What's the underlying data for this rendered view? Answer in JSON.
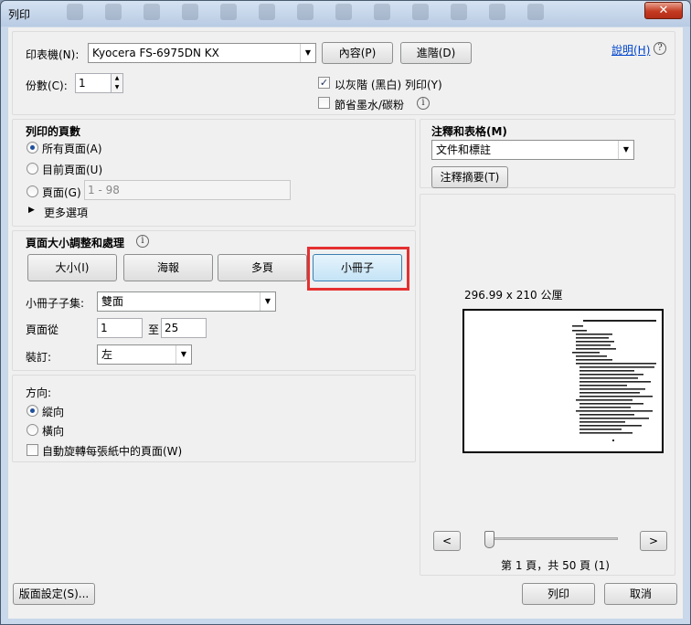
{
  "window": {
    "title": "列印",
    "close_glyph": "✕"
  },
  "top": {
    "printer_label": "印表機(N):",
    "printer_value": "Kyocera FS-6975DN KX",
    "properties_button": "內容(P)",
    "advanced_button": "進階(D)",
    "help_link": "說明(H)",
    "copies_label": "份數(C):",
    "copies_value": "1",
    "grayscale_label": "以灰階 (黑白) 列印(Y)",
    "grayscale_checked": true,
    "save_ink_label": "節省墨水/碳粉",
    "save_ink_checked": false
  },
  "pages_to_print": {
    "heading": "列印的頁數",
    "all_pages": "所有頁面(A)",
    "current_page": "目前頁面(U)",
    "pages": "頁面(G)",
    "pages_value": "1 - 98",
    "more_options": "更多選項",
    "selected": "all"
  },
  "sizing": {
    "heading": "頁面大小調整和處理",
    "buttons": [
      "大小(I)",
      "海報",
      "多頁",
      "小冊子"
    ],
    "selected": "小冊子",
    "subset_label": "小冊子子集:",
    "subset_value": "雙面",
    "pages_from_label": "頁面從",
    "from_value": "1",
    "to_label": "至",
    "to_value": "25",
    "binding_label": "裝訂:",
    "binding_value": "左"
  },
  "orientation": {
    "heading": "方向:",
    "portrait": "縱向",
    "landscape": "橫向",
    "selected": "portrait",
    "auto_rotate_label": "自動旋轉每張紙中的頁面(W)",
    "auto_rotate_checked": false
  },
  "comments": {
    "heading": "注釋和表格(M)",
    "value": "文件和標註",
    "summarize_button": "注釋摘要(T)"
  },
  "preview": {
    "size_text": "296.99 x 210 公厘",
    "page_info": "第 1 頁，共 50 頁 (1)",
    "prev_button": "<",
    "next_button": ">",
    "slider_position": 0.02
  },
  "footer": {
    "page_setup_button": "版面設定(S)...",
    "print_button": "列印",
    "cancel_button": "取消"
  },
  "icons": {
    "dropdown": "▼",
    "spin_up": "▲",
    "spin_down": "▼",
    "triangle_right": "▶",
    "check": "✓",
    "info": "i",
    "help": "?"
  }
}
